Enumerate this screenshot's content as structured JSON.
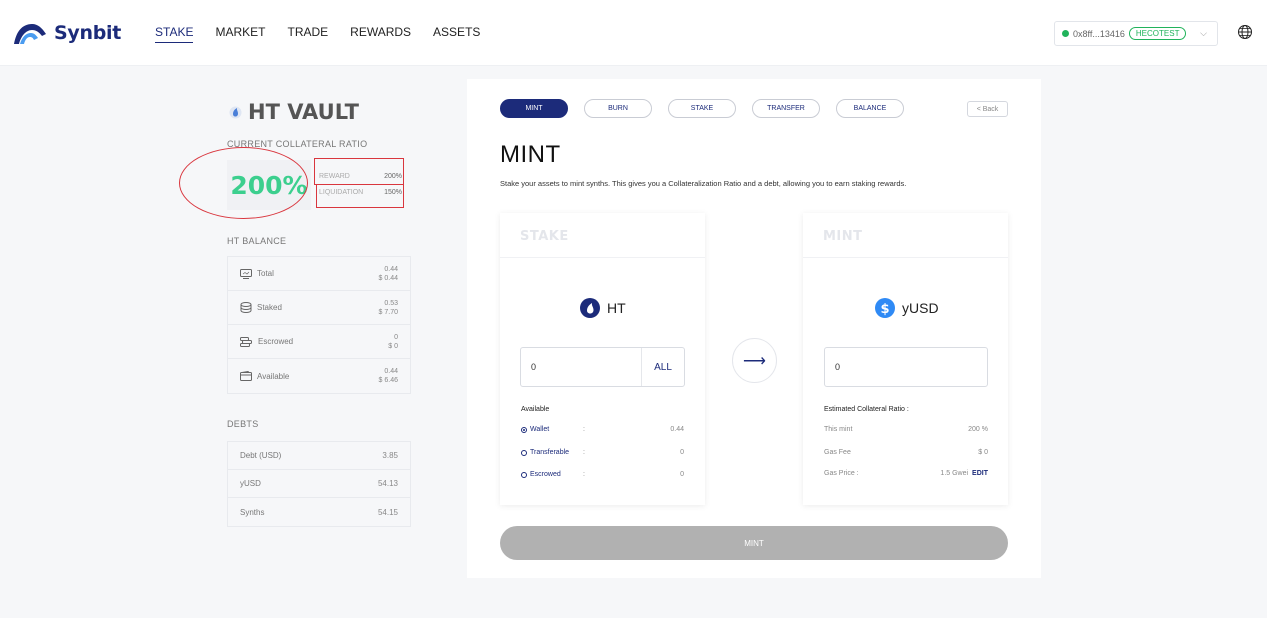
{
  "header": {
    "brand": "Synbit",
    "nav": [
      "STAKE",
      "MARKET",
      "TRADE",
      "REWARDS",
      "ASSETS"
    ],
    "wallet_address": "0x8ff...13416",
    "network": "HECOTEST"
  },
  "vault": {
    "title": "HT VAULT",
    "ratio_label": "CURRENT COLLATERAL RATIO",
    "ratio_value": "200%",
    "reward_label": "REWARD",
    "reward_value": "200%",
    "liquidation_label": "LIQUIDATION",
    "liquidation_value": "150%",
    "balance_label": "HT BALANCE",
    "balances": [
      {
        "label": "Total",
        "amount": "0.44",
        "usd": "$ 0.44",
        "icon": "monitor-icon"
      },
      {
        "label": "Staked",
        "amount": "0.53",
        "usd": "$ 7.70",
        "icon": "database-icon"
      },
      {
        "label": "Escrowed",
        "amount": "0",
        "usd": "$ 0",
        "icon": "coins-icon"
      },
      {
        "label": "Available",
        "amount": "0.44",
        "usd": "$ 6.46",
        "icon": "wallet-icon"
      }
    ],
    "debts_label": "DEBTS",
    "debts": [
      {
        "label": "Debt (USD)",
        "value": "3.85"
      },
      {
        "label": "yUSD",
        "value": "54.13"
      },
      {
        "label": "Synths",
        "value": "54.15"
      }
    ]
  },
  "main": {
    "tabs": [
      "MINT",
      "BURN",
      "STAKE",
      "TRANSFER",
      "BALANCE"
    ],
    "back": "< Back",
    "title": "MINT",
    "description": "Stake your assets to mint synths. This gives you a Collateralization Ratio and a debt, allowing you to earn staking rewards.",
    "stake": {
      "heading": "STAKE",
      "asset": "HT",
      "input_value": "0",
      "all_label": "ALL",
      "available_label": "Available",
      "sources": [
        {
          "label": "Wallet",
          "colon": ":",
          "value": "0.44",
          "selected": true
        },
        {
          "label": "Transferable",
          "colon": ":",
          "value": "0",
          "selected": false
        },
        {
          "label": "Escrowed",
          "colon": ":",
          "value": "0",
          "selected": false
        }
      ]
    },
    "mint": {
      "heading": "MINT",
      "asset": "yUSD",
      "input_value": "0",
      "estimate_label": "Estimated Collateral Ratio :",
      "this_mint_label": "This mint",
      "this_mint_value": "200 %",
      "gas_fee_label": "Gas Fee",
      "gas_fee_value": "$ 0",
      "gas_price_label": "Gas Price :",
      "gas_price_value": "1.5 Gwei",
      "edit_label": "EDIT"
    },
    "mint_button": "MINT"
  },
  "colors": {
    "brand": "#1c2b7a",
    "ratio_green": "#3ccf8e",
    "annotation_red": "#d9363e",
    "network_green": "#21b35b"
  }
}
